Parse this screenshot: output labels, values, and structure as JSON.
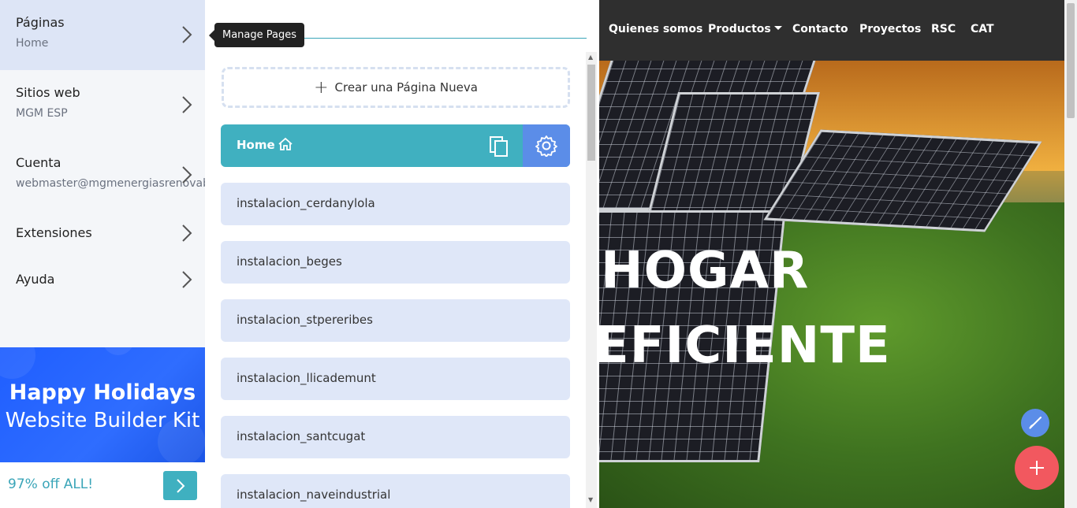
{
  "sidebar": {
    "items": [
      {
        "title": "Páginas",
        "sub": "Home"
      },
      {
        "title": "Sitios web",
        "sub": "MGM ESP"
      },
      {
        "title": "Cuenta",
        "sub": "webmaster@mgmenergiasrenovables"
      },
      {
        "title": "Extensiones",
        "sub": ""
      },
      {
        "title": "Ayuda",
        "sub": ""
      }
    ],
    "promo": {
      "line1": "Happy Holidays",
      "line2": "Website Builder Kit",
      "offer": "97% off ALL!"
    }
  },
  "tooltip": "Manage Pages",
  "pages": {
    "new_page_label": "Crear una Página Nueva",
    "home_label": "Home",
    "list": [
      "instalacion_cerdanylola",
      "instalacion_beges",
      "instalacion_stpereribes",
      "instalacion_llicademunt",
      "instalacion_santcugat",
      "instalacion_naveindustrial"
    ]
  },
  "preview": {
    "nav": [
      "Quienes somos",
      "Productos",
      "Contacto",
      "Proyectos",
      "RSC",
      "CAT"
    ],
    "hero_line1": "HOGAR",
    "hero_line2": "EFICIENTE"
  },
  "colors": {
    "accent": "#40b0c0",
    "gear_bg": "#5b8de8",
    "fab_add": "#f2585f",
    "promo_bg": "#1f5eff",
    "page_row_bg": "#dfe7f8"
  },
  "icons": [
    "chevron-right-icon",
    "plus-icon",
    "home-icon",
    "copy-icon",
    "gear-icon",
    "brush-icon",
    "add-icon"
  ]
}
